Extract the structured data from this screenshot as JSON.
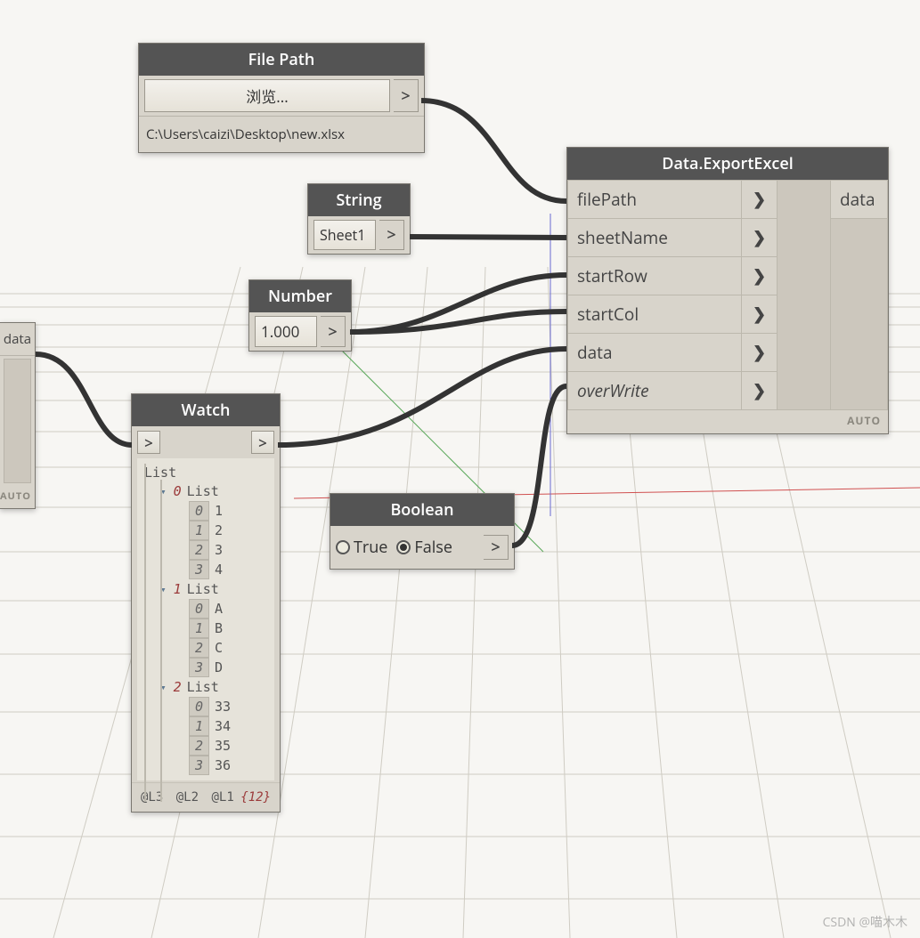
{
  "watermark": "CSDN @喵木木",
  "partial_source": {
    "out_label": "data",
    "auto": "AUTO"
  },
  "file_path_node": {
    "title": "File Path",
    "browse_label": "浏览...",
    "path_value": "C:\\Users\\caizi\\Desktop\\new.xlsx"
  },
  "string_node": {
    "title": "String",
    "value": "Sheet1"
  },
  "number_node": {
    "title": "Number",
    "value": "1.000"
  },
  "boolean_node": {
    "title": "Boolean",
    "true_label": "True",
    "false_label": "False",
    "selected": "False"
  },
  "watch_node": {
    "title": "Watch",
    "list_label": "List",
    "lists": [
      {
        "index": "0",
        "items": [
          {
            "i": "0",
            "v": "1"
          },
          {
            "i": "1",
            "v": "2"
          },
          {
            "i": "2",
            "v": "3"
          },
          {
            "i": "3",
            "v": "4"
          }
        ]
      },
      {
        "index": "1",
        "items": [
          {
            "i": "0",
            "v": "A"
          },
          {
            "i": "1",
            "v": "B"
          },
          {
            "i": "2",
            "v": "C"
          },
          {
            "i": "3",
            "v": "D"
          }
        ]
      },
      {
        "index": "2",
        "items": [
          {
            "i": "0",
            "v": "33"
          },
          {
            "i": "1",
            "v": "34"
          },
          {
            "i": "2",
            "v": "35"
          },
          {
            "i": "3",
            "v": "36"
          }
        ]
      }
    ],
    "levels": [
      "@L3",
      "@L2",
      "@L1"
    ],
    "count": "{12}"
  },
  "export_node": {
    "title": "Data.ExportExcel",
    "inputs": [
      "filePath",
      "sheetName",
      "startRow",
      "startCol",
      "data",
      "overWrite"
    ],
    "output": "data",
    "auto": "AUTO"
  }
}
